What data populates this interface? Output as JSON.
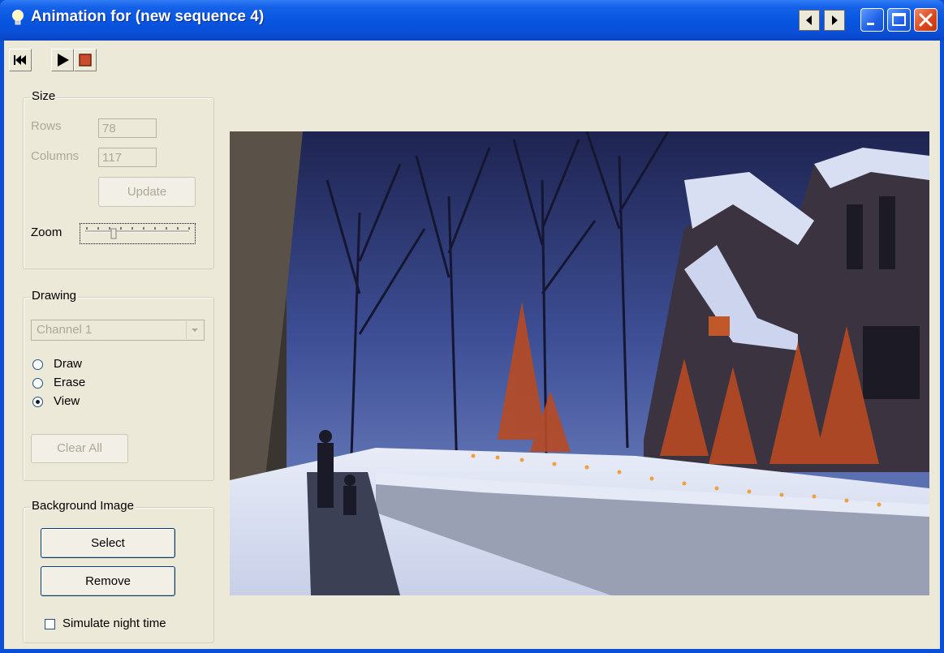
{
  "window": {
    "title": "Animation for (new sequence 4)"
  },
  "toolbar": {
    "rewind_icon": "rewind-icon",
    "play_icon": "play-icon",
    "stop_icon": "stop-icon"
  },
  "size": {
    "legend": "Size",
    "rows_label": "Rows",
    "rows_value": "78",
    "columns_label": "Columns",
    "columns_value": "117",
    "update_label": "Update",
    "zoom_label": "Zoom"
  },
  "drawing": {
    "legend": "Drawing",
    "channel_value": "Channel 1",
    "draw_label": "Draw",
    "erase_label": "Erase",
    "view_label": "View",
    "selected_mode": "View",
    "clear_label": "Clear All"
  },
  "background": {
    "legend": "Background Image",
    "select_label": "Select",
    "remove_label": "Remove",
    "night_label": "Simulate night time",
    "night_checked": false
  },
  "colors": {
    "titlebar": "#0a4fd8",
    "dialog": "#ece9d8",
    "sky": "#26305a"
  }
}
